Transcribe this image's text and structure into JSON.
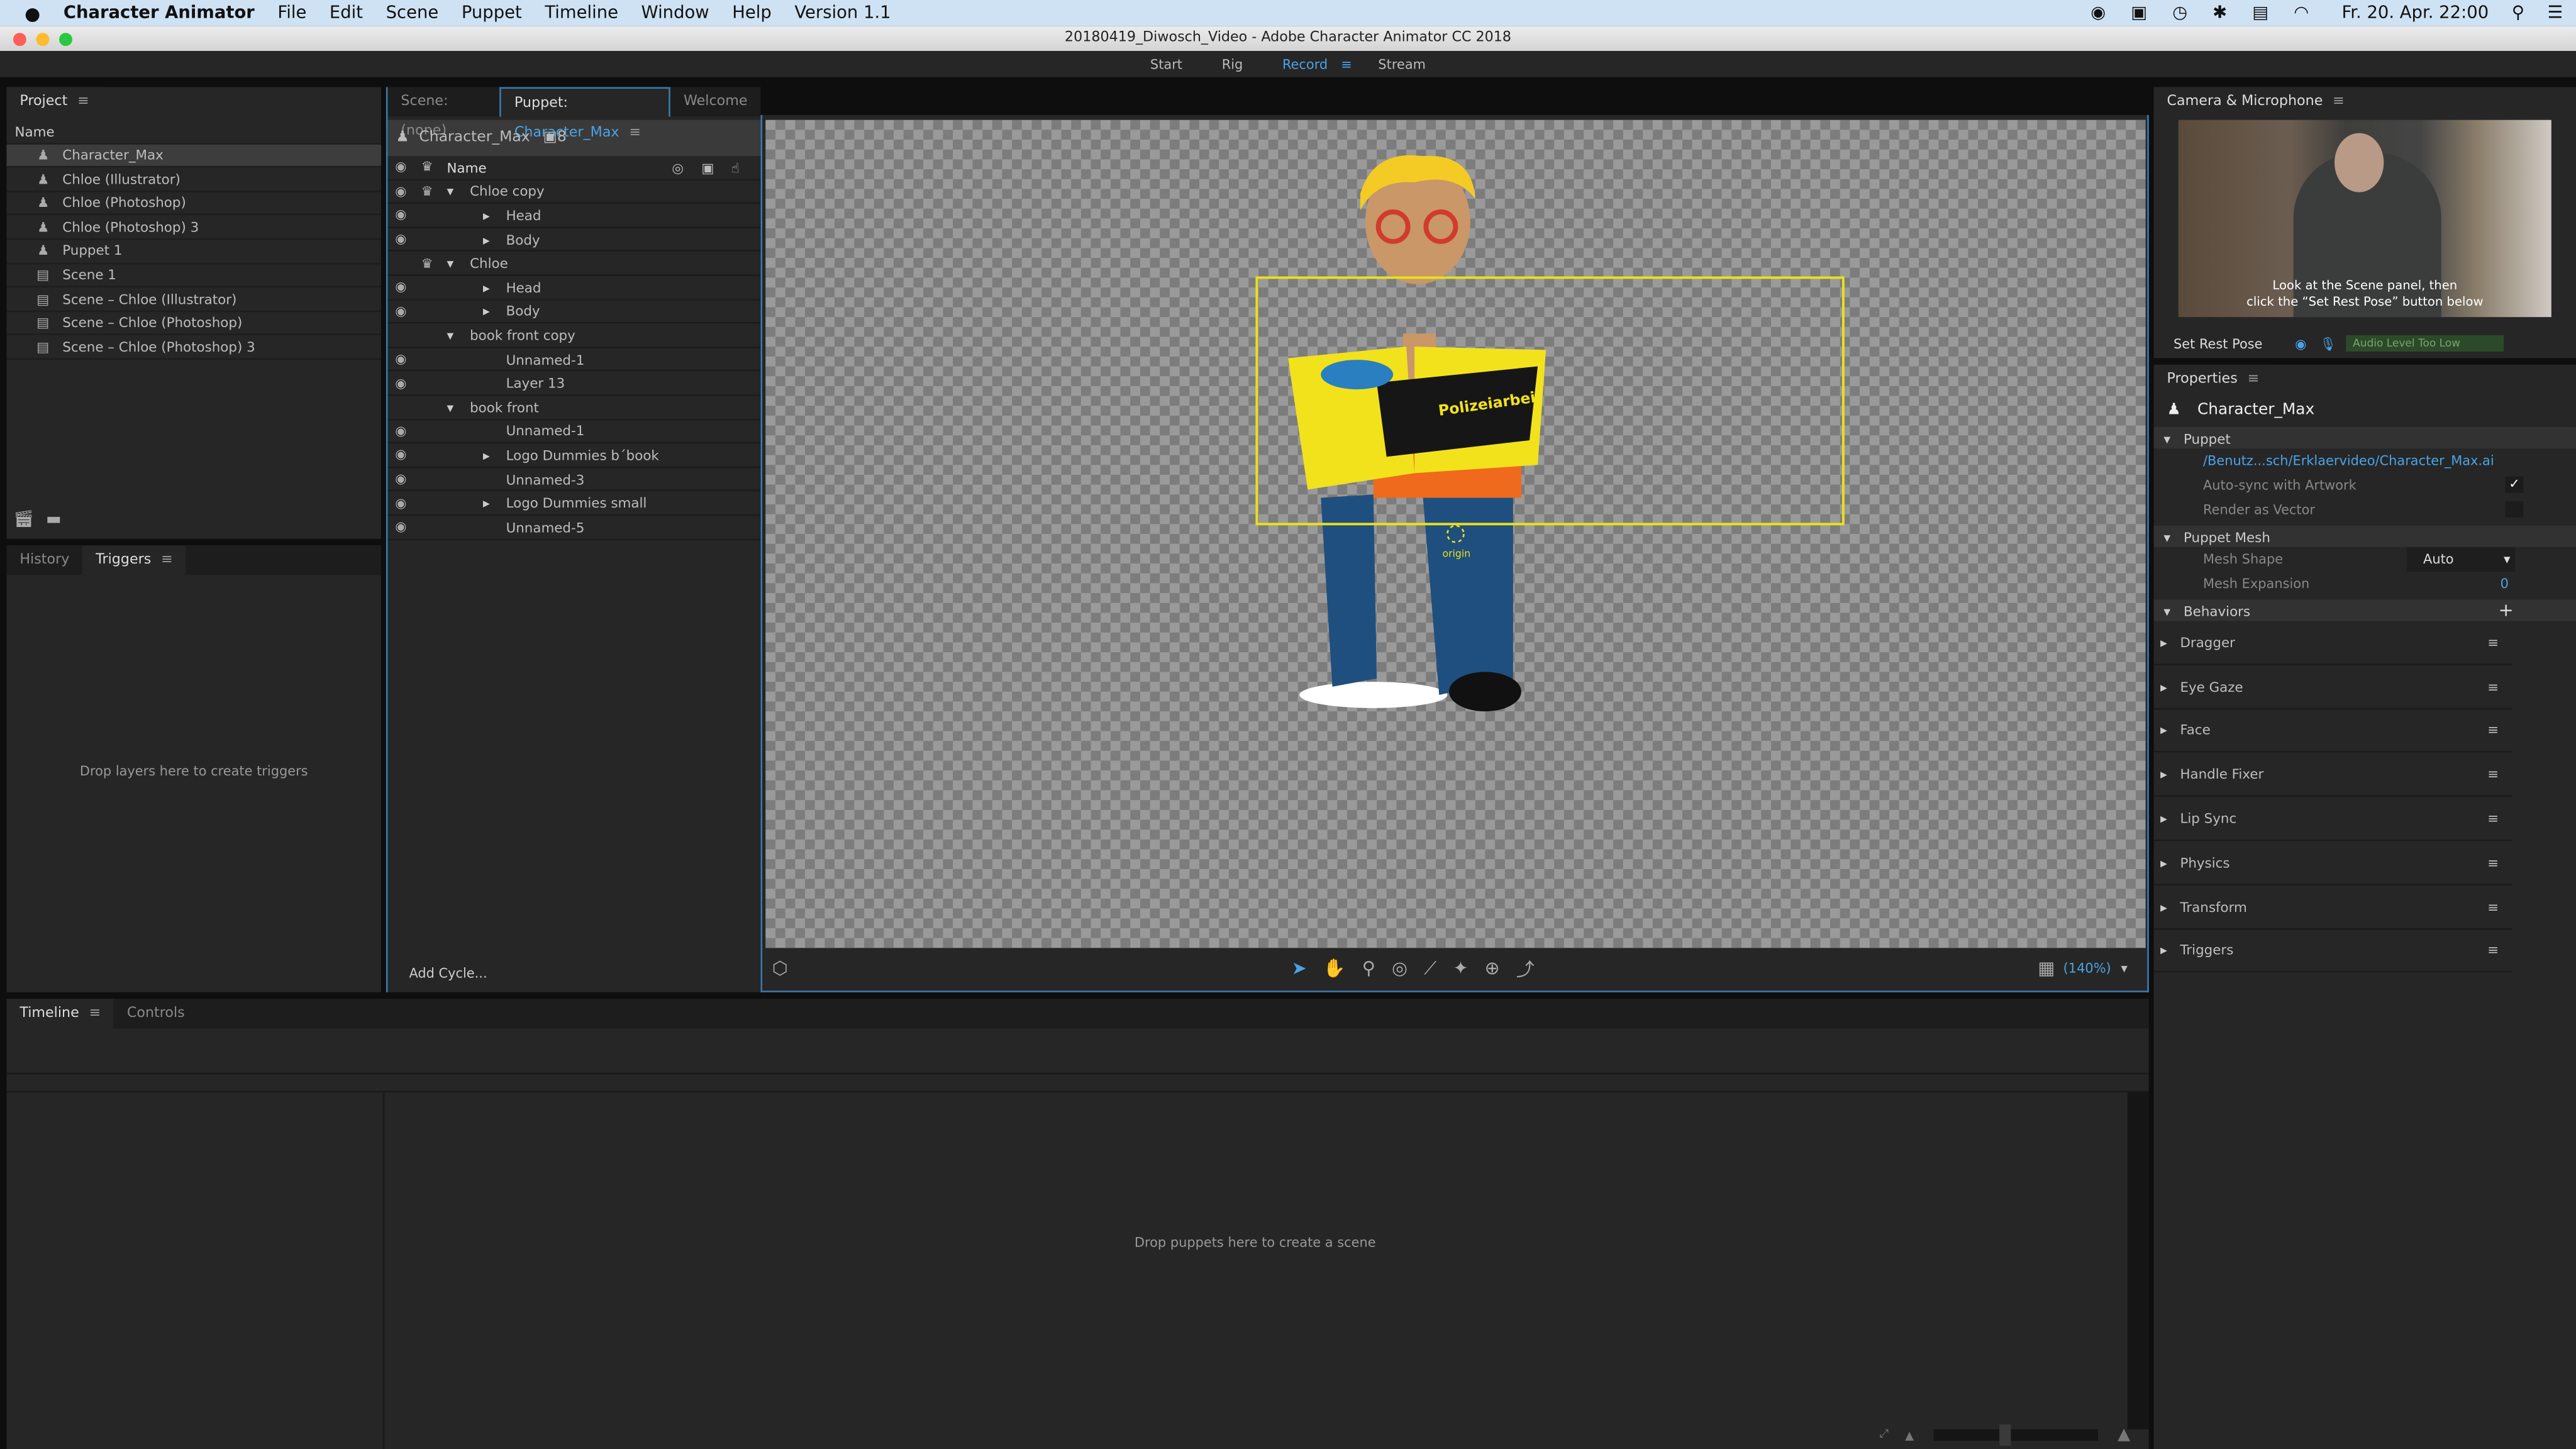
{
  "menubar": {
    "app": "Character Animator",
    "items": [
      "File",
      "Edit",
      "Scene",
      "Puppet",
      "Timeline",
      "Window",
      "Help",
      "Version 1.1"
    ],
    "clock": "Fr. 20. Apr.  22:00"
  },
  "window": {
    "title": "20180419_Diwosch_Video - Adobe Character Animator CC 2018"
  },
  "workspaces": {
    "items": [
      "Start",
      "Rig",
      "Record",
      "Stream"
    ],
    "active": "Record"
  },
  "project": {
    "title": "Project",
    "column": "Name",
    "items": [
      {
        "name": "Character_Max",
        "type": "puppet"
      },
      {
        "name": "Chloe (Illustrator)",
        "type": "puppet"
      },
      {
        "name": "Chloe (Photoshop)",
        "type": "puppet"
      },
      {
        "name": "Chloe (Photoshop) 3",
        "type": "puppet"
      },
      {
        "name": "Puppet 1",
        "type": "puppet"
      },
      {
        "name": "Scene 1",
        "type": "scene"
      },
      {
        "name": "Scene – Chloe (Illustrator)",
        "type": "scene"
      },
      {
        "name": "Scene – Chloe (Photoshop)",
        "type": "scene"
      },
      {
        "name": "Scene – Chloe (Photoshop) 3",
        "type": "scene"
      }
    ]
  },
  "lower_left": {
    "tabs": [
      "History",
      "Triggers"
    ],
    "active": "Triggers",
    "empty": "Drop layers here to create triggers"
  },
  "tabs": {
    "scene": "Scene: (none)",
    "puppet_prefix": "Puppet: ",
    "puppet_name": "Character_Max",
    "welcome": "Welcome"
  },
  "puppet": {
    "name": "Character_Max",
    "handle_count": "8",
    "column": "Name",
    "add_cycle": "Add Cycle...",
    "layers": [
      {
        "name": "Chloe copy",
        "depth": 0,
        "expanded": true,
        "eye": true,
        "crown": true
      },
      {
        "name": "Head",
        "depth": 1,
        "expanded": false,
        "eye": true
      },
      {
        "name": "Body",
        "depth": 1,
        "expanded": false,
        "eye": true
      },
      {
        "name": "Chloe",
        "depth": 0,
        "expanded": true,
        "eye": false,
        "crown": true
      },
      {
        "name": "Head",
        "depth": 1,
        "expanded": false,
        "eye": true
      },
      {
        "name": "Body",
        "depth": 1,
        "expanded": false,
        "eye": true
      },
      {
        "name": "book front copy",
        "depth": 0,
        "expanded": true,
        "eye": false
      },
      {
        "name": "Unnamed-1",
        "depth": 1,
        "eye": true
      },
      {
        "name": "Layer 13",
        "depth": 1,
        "eye": true
      },
      {
        "name": "book front",
        "depth": 0,
        "expanded": true,
        "eye": false
      },
      {
        "name": "Unnamed-1",
        "depth": 1,
        "eye": true
      },
      {
        "name": "Logo Dummies b´book",
        "depth": 1,
        "expanded": false,
        "eye": true
      },
      {
        "name": "Unnamed-3",
        "depth": 1,
        "eye": true
      },
      {
        "name": "Logo Dummies small",
        "depth": 1,
        "expanded": false,
        "eye": true
      },
      {
        "name": "Unnamed-5",
        "depth": 1,
        "eye": true
      }
    ]
  },
  "canvas": {
    "origin_label": "origin",
    "zoom": "(140%)",
    "book_text": "Polizeiarbeit"
  },
  "timeline": {
    "tabs": [
      "Timeline",
      "Controls"
    ],
    "active": "Timeline",
    "empty": "Drop puppets here to create a scene"
  },
  "camera": {
    "title": "Camera & Microphone",
    "overlay_line1": "Look at the Scene panel, then",
    "overlay_line2": "click the “Set Rest Pose” button below",
    "set_rest_pose": "Set Rest Pose",
    "audio_status": "Audio Level Too Low"
  },
  "properties": {
    "title": "Properties",
    "name": "Character_Max",
    "puppet_section": "Puppet",
    "path": "/Benutz...sch/Erklaervideo/Character_Max.ai",
    "auto_sync": "Auto-sync with Artwork",
    "auto_sync_checked": true,
    "render_vector": "Render as Vector",
    "render_vector_checked": false,
    "mesh_section": "Puppet Mesh",
    "mesh_shape_label": "Mesh Shape",
    "mesh_shape": "Auto",
    "mesh_expansion_label": "Mesh Expansion",
    "mesh_expansion": "0",
    "behaviors_section": "Behaviors",
    "behaviors": [
      "Dragger",
      "Eye Gaze",
      "Face",
      "Handle Fixer",
      "Lip Sync",
      "Physics",
      "Transform",
      "Triggers"
    ]
  },
  "colors": {
    "accent": "#4aa3e6",
    "selection": "#e8e01c",
    "panel": "#262626"
  }
}
